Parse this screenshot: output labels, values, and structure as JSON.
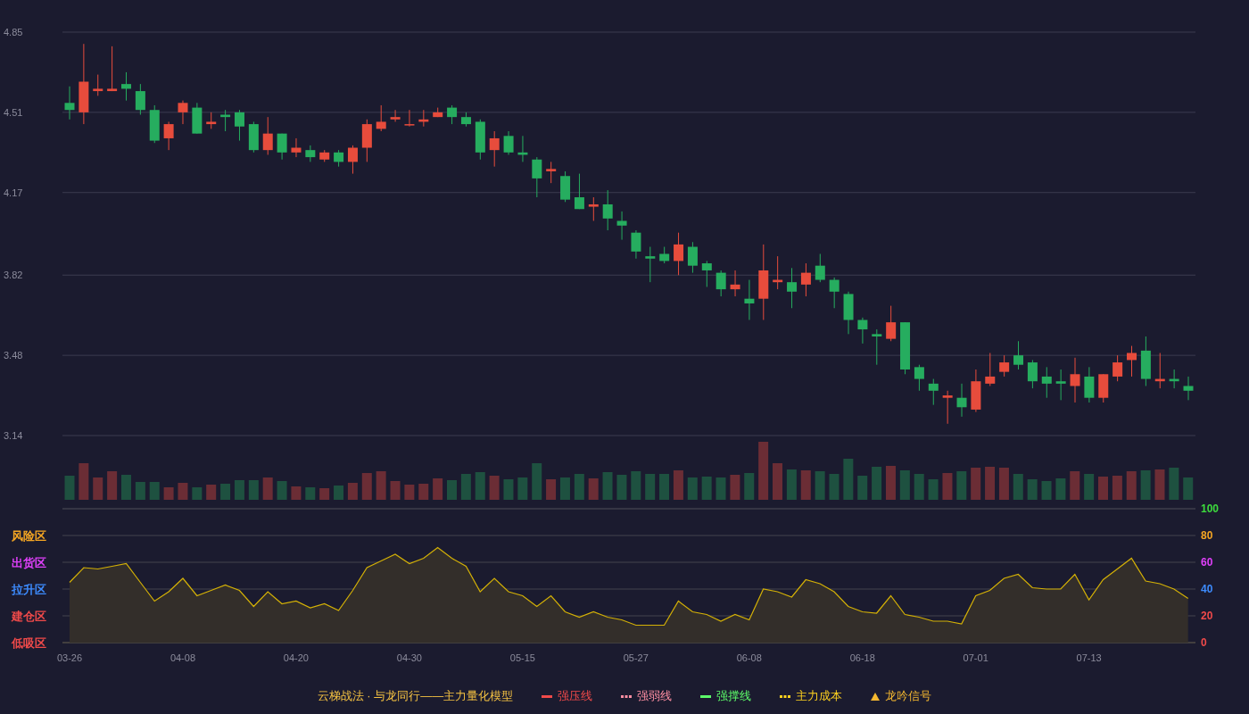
{
  "price_chart": {
    "chart_data": {
      "type": "candlestick",
      "categories": [
        null,
        null,
        null,
        null,
        null,
        null,
        null,
        null,
        null,
        null,
        null,
        null,
        null,
        null,
        null,
        null,
        null,
        null,
        null,
        null,
        null,
        null,
        null,
        null,
        null,
        null,
        null,
        null,
        null,
        null,
        null,
        null,
        null,
        null,
        null,
        null,
        null,
        null,
        null,
        null,
        null,
        null,
        null,
        null,
        null,
        null,
        null,
        null,
        null,
        null,
        null,
        null,
        null,
        null,
        null,
        null,
        null,
        null,
        null,
        null,
        null,
        null,
        null,
        null,
        null,
        null,
        null,
        null,
        null,
        null,
        null,
        null,
        null,
        null,
        null,
        null,
        null,
        null,
        null,
        null
      ],
      "ylim": [
        3.14,
        4.85
      ],
      "grid": true,
      "yticks": [
        {
          "value": 4.85,
          "label": "4.85"
        },
        {
          "value": 4.51,
          "label": "4.51"
        },
        {
          "value": 4.17,
          "label": "4.17"
        },
        {
          "value": 3.82,
          "label": "3.82"
        },
        {
          "value": 3.48,
          "label": "3.48"
        },
        {
          "value": 3.14,
          "label": "3.14"
        }
      ],
      "ohlc": [
        [
          4.55,
          4.62,
          4.48,
          4.52
        ],
        [
          4.51,
          4.8,
          4.46,
          4.64
        ],
        [
          4.6,
          4.67,
          4.58,
          4.61
        ],
        [
          4.6,
          4.79,
          4.6,
          4.61
        ],
        [
          4.63,
          4.68,
          4.56,
          4.61
        ],
        [
          4.6,
          4.63,
          4.5,
          4.52
        ],
        [
          4.52,
          4.54,
          4.38,
          4.39
        ],
        [
          4.4,
          4.47,
          4.35,
          4.46
        ],
        [
          4.51,
          4.56,
          4.46,
          4.55
        ],
        [
          4.53,
          4.55,
          4.42,
          4.42
        ],
        [
          4.46,
          4.51,
          4.44,
          4.47
        ],
        [
          4.5,
          4.52,
          4.43,
          4.49
        ],
        [
          4.51,
          4.52,
          4.39,
          4.45
        ],
        [
          4.46,
          4.47,
          4.34,
          4.35
        ],
        [
          4.35,
          4.49,
          4.33,
          4.42
        ],
        [
          4.42,
          4.42,
          4.31,
          4.34
        ],
        [
          4.34,
          4.4,
          4.32,
          4.36
        ],
        [
          4.35,
          4.37,
          4.3,
          4.32
        ],
        [
          4.31,
          4.35,
          4.3,
          4.34
        ],
        [
          4.34,
          4.35,
          4.28,
          4.3
        ],
        [
          4.3,
          4.37,
          4.25,
          4.36
        ],
        [
          4.36,
          4.48,
          4.3,
          4.46
        ],
        [
          4.44,
          4.54,
          4.43,
          4.47
        ],
        [
          4.48,
          4.52,
          4.47,
          4.49
        ],
        [
          4.46,
          4.52,
          4.45,
          4.46
        ],
        [
          4.47,
          4.52,
          4.45,
          4.48
        ],
        [
          4.49,
          4.53,
          4.49,
          4.51
        ],
        [
          4.53,
          4.54,
          4.46,
          4.49
        ],
        [
          4.49,
          4.51,
          4.45,
          4.46
        ],
        [
          4.47,
          4.48,
          4.31,
          4.34
        ],
        [
          4.35,
          4.43,
          4.28,
          4.4
        ],
        [
          4.41,
          4.43,
          4.33,
          4.34
        ],
        [
          4.34,
          4.41,
          4.3,
          4.33
        ],
        [
          4.31,
          4.32,
          4.15,
          4.23
        ],
        [
          4.26,
          4.3,
          4.21,
          4.27
        ],
        [
          4.24,
          4.26,
          4.13,
          4.14
        ],
        [
          4.15,
          4.25,
          4.1,
          4.1
        ],
        [
          4.11,
          4.15,
          4.05,
          4.12
        ],
        [
          4.12,
          4.18,
          4.01,
          4.06
        ],
        [
          4.05,
          4.09,
          3.97,
          4.03
        ],
        [
          4.0,
          4.01,
          3.89,
          3.92
        ],
        [
          3.9,
          3.94,
          3.79,
          3.89
        ],
        [
          3.91,
          3.94,
          3.87,
          3.88
        ],
        [
          3.88,
          4.0,
          3.82,
          3.95
        ],
        [
          3.94,
          3.96,
          3.83,
          3.86
        ],
        [
          3.87,
          3.88,
          3.77,
          3.84
        ],
        [
          3.83,
          3.84,
          3.73,
          3.76
        ],
        [
          3.76,
          3.84,
          3.73,
          3.78
        ],
        [
          3.72,
          3.8,
          3.63,
          3.7
        ],
        [
          3.72,
          3.95,
          3.63,
          3.84
        ],
        [
          3.79,
          3.9,
          3.76,
          3.8
        ],
        [
          3.79,
          3.85,
          3.68,
          3.75
        ],
        [
          3.78,
          3.87,
          3.73,
          3.83
        ],
        [
          3.86,
          3.91,
          3.79,
          3.8
        ],
        [
          3.8,
          3.81,
          3.68,
          3.75
        ],
        [
          3.74,
          3.75,
          3.57,
          3.63
        ],
        [
          3.63,
          3.64,
          3.53,
          3.59
        ],
        [
          3.57,
          3.59,
          3.44,
          3.56
        ],
        [
          3.55,
          3.69,
          3.54,
          3.62
        ],
        [
          3.62,
          3.62,
          3.4,
          3.42
        ],
        [
          3.43,
          3.44,
          3.33,
          3.38
        ],
        [
          3.36,
          3.38,
          3.27,
          3.33
        ],
        [
          3.3,
          3.33,
          3.19,
          3.31
        ],
        [
          3.3,
          3.36,
          3.22,
          3.26
        ],
        [
          3.25,
          3.42,
          3.24,
          3.37
        ],
        [
          3.36,
          3.49,
          3.35,
          3.39
        ],
        [
          3.41,
          3.48,
          3.39,
          3.45
        ],
        [
          3.48,
          3.54,
          3.42,
          3.44
        ],
        [
          3.45,
          3.46,
          3.34,
          3.37
        ],
        [
          3.39,
          3.43,
          3.3,
          3.36
        ],
        [
          3.37,
          3.42,
          3.29,
          3.36
        ],
        [
          3.35,
          3.47,
          3.28,
          3.4
        ],
        [
          3.39,
          3.43,
          3.28,
          3.3
        ],
        [
          3.3,
          3.4,
          3.28,
          3.4
        ],
        [
          3.39,
          3.48,
          3.37,
          3.45
        ],
        [
          3.46,
          3.52,
          3.39,
          3.49
        ],
        [
          3.5,
          3.56,
          3.35,
          3.38
        ],
        [
          3.37,
          3.49,
          3.34,
          3.38
        ],
        [
          3.38,
          3.42,
          3.34,
          3.37
        ],
        [
          3.35,
          3.39,
          3.29,
          3.33
        ]
      ]
    }
  },
  "indicator": {
    "zones": [
      {
        "label": "风险区",
        "color": "#f5a623"
      },
      {
        "label": "出货区",
        "color": "#e040fb"
      },
      {
        "label": "拉升区",
        "color": "#3d8bfd"
      },
      {
        "label": "建仓区",
        "color": "#f04a4a"
      },
      {
        "label": "低吸区",
        "color": "#f04a4a"
      }
    ],
    "axis_labels": [
      {
        "label": "100",
        "color": "#3ddc3d"
      },
      {
        "label": "80",
        "color": "#f5a623"
      },
      {
        "label": "60",
        "color": "#e040fb"
      },
      {
        "label": "40",
        "color": "#3d8bfd"
      },
      {
        "label": "20",
        "color": "#f04a4a"
      },
      {
        "label": "0",
        "color": "#f04a4a"
      }
    ],
    "chart_data": {
      "type": "area",
      "categories": [
        "03-26",
        null,
        null,
        null,
        null,
        null,
        null,
        null,
        "04-08",
        null,
        null,
        null,
        null,
        null,
        null,
        null,
        "04-20",
        null,
        null,
        null,
        null,
        null,
        null,
        null,
        "04-30",
        null,
        null,
        null,
        null,
        null,
        null,
        null,
        "05-15",
        null,
        null,
        null,
        null,
        null,
        null,
        null,
        "05-27",
        null,
        null,
        null,
        null,
        null,
        null,
        null,
        "06-08",
        null,
        null,
        null,
        null,
        null,
        null,
        null,
        "06-18",
        null,
        null,
        null,
        null,
        null,
        null,
        null,
        "07-01",
        null,
        null,
        null,
        null,
        null,
        null,
        null,
        "07-13",
        null,
        null,
        null,
        null,
        null,
        null,
        null
      ],
      "series": [
        {
          "color": "#d4b106",
          "values": [
            45,
            56,
            55,
            57,
            59,
            45,
            31,
            38,
            48,
            35,
            39,
            43,
            39,
            27,
            38,
            29,
            31,
            26,
            29,
            24,
            39,
            56,
            61,
            66,
            59,
            63,
            71,
            63,
            57,
            38,
            48,
            38,
            35,
            27,
            35,
            23,
            19,
            23,
            19,
            17,
            13,
            13,
            13,
            31,
            23,
            21,
            16,
            21,
            17,
            40,
            38,
            34,
            47,
            44,
            38,
            27,
            23,
            22,
            35,
            21,
            19,
            16,
            16,
            14,
            35,
            39,
            48,
            51,
            41,
            40,
            40,
            51,
            32,
            47,
            55,
            63,
            46,
            44,
            40,
            33
          ]
        }
      ],
      "ylim": [
        0,
        100
      ],
      "grid": true,
      "yticks": [
        100,
        80,
        60,
        40,
        20,
        0
      ]
    }
  },
  "legend": {
    "title": "云梯战法 · 与龙同行——主力量化模型",
    "items": [
      {
        "kind": "solid",
        "label": "强压线",
        "color": "#f04a4a"
      },
      {
        "kind": "dashed",
        "label": "强弱线",
        "color": "#ff8fa3"
      },
      {
        "kind": "solid",
        "label": "强撑线",
        "color": "#5dfc6a"
      },
      {
        "kind": "dashed",
        "label": "主力成本",
        "color": "#ffd21f"
      },
      {
        "kind": "triangle",
        "label": "龙吟信号",
        "color": "#f5b830"
      }
    ]
  }
}
